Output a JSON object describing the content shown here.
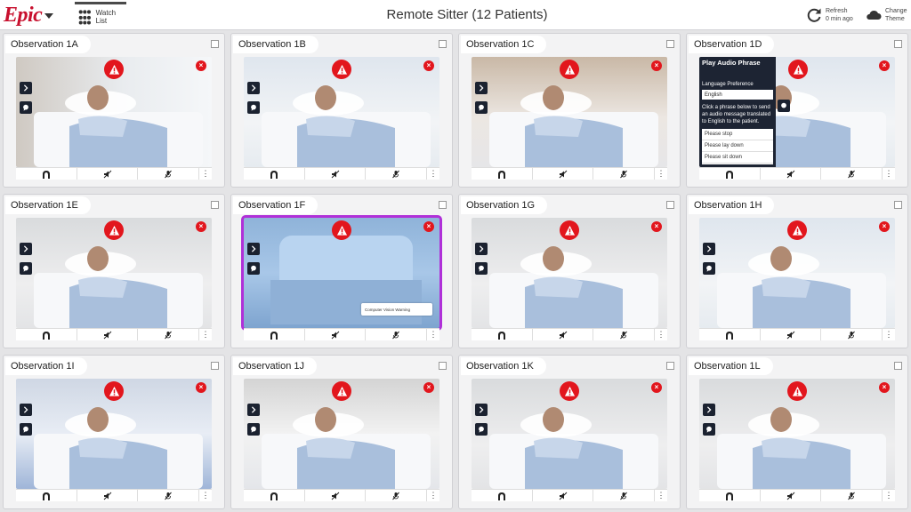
{
  "header": {
    "logo": "Epic",
    "watch_list_label": "Watch List",
    "title": "Remote Sitter (12 Patients)",
    "refresh_label": "Refresh",
    "refresh_time": "0 min ago",
    "theme_label_1": "Change",
    "theme_label_2": "Theme"
  },
  "colors": {
    "brand": "#c8102e",
    "alert": "#e2161d",
    "selected_outline": "#b030d8",
    "dark_control": "#1b2230"
  },
  "icons": {
    "expand": "chevron-right-icon",
    "chat": "chat-bubble-icon",
    "alert": "warning-triangle-icon",
    "close": "close-icon",
    "camera": "camera-arch-icon",
    "mute_speaker": "speaker-muted-icon",
    "mute_mic": "mic-muted-icon",
    "more": "more-vertical-icon"
  },
  "panels": [
    {
      "id": "1A",
      "label": "Observation 1A",
      "scene": "window-room"
    },
    {
      "id": "1B",
      "label": "Observation 1B",
      "scene": "bright-room"
    },
    {
      "id": "1C",
      "label": "Observation 1C",
      "scene": "warm-room"
    },
    {
      "id": "1D",
      "label": "Observation 1D",
      "scene": "bright-room"
    },
    {
      "id": "1E",
      "label": "Observation 1E",
      "scene": "pale-room"
    },
    {
      "id": "1F",
      "label": "Observation 1F",
      "scene": "pillow",
      "selected": true
    },
    {
      "id": "1G",
      "label": "Observation 1G",
      "scene": "pale-room"
    },
    {
      "id": "1H",
      "label": "Observation 1H",
      "scene": "bright-room"
    },
    {
      "id": "1I",
      "label": "Observation 1I",
      "scene": "blue-room"
    },
    {
      "id": "1J",
      "label": "Observation 1J",
      "scene": "closeup"
    },
    {
      "id": "1K",
      "label": "Observation 1K",
      "scene": "pale-room"
    },
    {
      "id": "1L",
      "label": "Observation 1L",
      "scene": "pale-room"
    }
  ],
  "audio_panel": {
    "title": "Play Audio Phrase",
    "language_label": "Language Preference",
    "language_value": "English",
    "instructions": "Click a phrase below to send an audio message translated to English to the patient.",
    "phrases": [
      "Please stop",
      "Please lay down",
      "Please sit down"
    ]
  },
  "toast": {
    "text": "Computer Vision Warning"
  }
}
